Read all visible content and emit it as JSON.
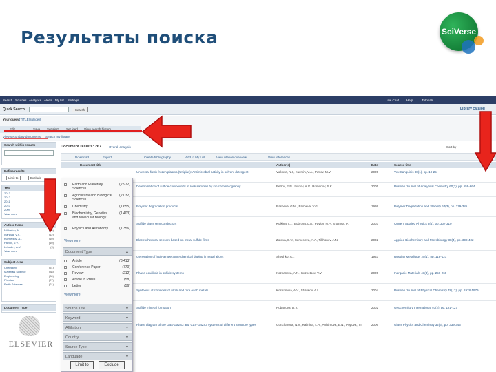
{
  "slide": {
    "title": "Результаты поиска",
    "logo_text": "SciVerse"
  },
  "nav": {
    "items": [
      "Search",
      "Sources",
      "Analytics",
      "Alerts",
      "My list",
      "Settings"
    ],
    "right": [
      "Live Chat",
      "Help",
      "Tutorials"
    ]
  },
  "search": {
    "quick_label": "Quick Search",
    "button": "Search",
    "library_link": "Library catalog"
  },
  "query": {
    "label": "Your query:",
    "value": "(TITLE(sulfide))",
    "tools": [
      "Edit",
      "Save",
      "Set alert",
      "Set feed",
      "View search history"
    ],
    "links": [
      "View secondary documents",
      "Search my library"
    ]
  },
  "results": {
    "label": "Document results:",
    "count": "267",
    "overall": "Overall analysis"
  },
  "toolbar": {
    "items": [
      "Download",
      "Export",
      "Create bibliography",
      "Add to My List",
      "View citation overview",
      "View references"
    ]
  },
  "sort_label": "Sort by",
  "table": {
    "columns": [
      "Document title",
      "Author(s)",
      "Date",
      "Source title"
    ]
  },
  "rows": [
    {
      "title": "Universal fresh frozen plasma (Uniplas): Antimicrobial activity in solvent detergent",
      "authors": "Volkova, N.I., Kuzmin, V.A., Petrov, M.V.",
      "year": "2005",
      "source": "Vox Sanguinis 88(1), pp. 19-25"
    },
    {
      "title": "Determination of sulfide compounds in rock samples by ion chromatography",
      "authors": "Petrov, E.N., Ivanov, A.V., Romanov, S.K.",
      "year": "2005",
      "source": "Russian Journal of Analytical Chemistry 60(7), pp. 659-664"
    },
    {
      "title": "Polymer degradation products",
      "authors": "Rasheva, G.M., Pasheva, V.G.",
      "year": "1999",
      "source": "Polymer Degradation and Stability 64(3), pp. 379-385"
    },
    {
      "title": "Sulfide glass semiconductors",
      "authors": "Kolkina, L.I., Bobrova, L.A., Pavlov, N.P., Shamsa, P.",
      "year": "2003",
      "source": "Current Applied Physics 3(4), pp. 307-310"
    },
    {
      "title": "Electrochemical sensors based on metal sulfide films",
      "authors": "Zotova, E.V., Semenova, A.A., Tikhonov, A.N.",
      "year": "2002",
      "source": "Applied Biochemistry and Microbiology 38(4), pp. 398-402"
    },
    {
      "title": "Generation of high-temperature chemical doping in metal alloys",
      "authors": "Sheshko, A.I.",
      "year": "1963",
      "source": "Russian Metallurgy 25(1), pp. 118-121"
    },
    {
      "title": "Phase equilibria in sulfide systems",
      "authors": "Kozhanova, A.N., Kuznetsov, V.V.",
      "year": "2005",
      "source": "Inorganic Materials 41(3), pp. 256-260"
    },
    {
      "title": "Synthesis of chlorides of alkali and rare earth metals",
      "authors": "Kostromina, A.V., Shatalov, A.I.",
      "year": "2004",
      "source": "Russian Journal of Physical Chemistry 78(12), pp. 1978-1979"
    },
    {
      "title": "Sulfide mineral formation",
      "authors": "Rubanova, D.V.",
      "year": "2002",
      "source": "Geochemistry International 40(2), pp. 121-127"
    },
    {
      "title": "Phase diagram of the GaS-Ga2S3 and CdS-Ga2S3 systems of different structure types",
      "authors": "Goncharova, N.V., Kalinina, L.A., Anisimova, E.N., Popova, T.I.",
      "year": "2006",
      "source": "Glass Physics and Chemistry 32(6), pp. 339-345"
    }
  ],
  "left": {
    "search_within": "Search within results",
    "limit_btn": "Limit to",
    "exclude_btn": "Exclude",
    "refine": "Refine results",
    "year_head": "Year",
    "years": [
      {
        "y": "2013",
        "n": "(1)"
      },
      {
        "y": "2012",
        "n": "(4)"
      },
      {
        "y": "2011",
        "n": "(4)"
      },
      {
        "y": "2010",
        "n": "(8)"
      },
      {
        "y": "2009",
        "n": "(3)"
      }
    ],
    "view_more": "View more",
    "author_head": "Author Name",
    "authors": [
      {
        "a": "Mikhailov, A.",
        "n": "(16)"
      },
      {
        "a": "Ivanova, V.S.",
        "n": "(12)"
      },
      {
        "a": "Kuznetsov, A.I.",
        "n": "(10)"
      },
      {
        "a": "Pavlov, V.V.",
        "n": "(10)"
      },
      {
        "a": "Lebedev, A.V.",
        "n": "(9)"
      }
    ],
    "subject_head": "Subject Area",
    "subjects": [
      {
        "s": "Chemistry",
        "n": "(51)"
      },
      {
        "s": "Materials Science",
        "n": "(38)"
      },
      {
        "s": "Engineering",
        "n": "(30)"
      },
      {
        "s": "Physics",
        "n": "(27)"
      },
      {
        "s": "Earth Sciences",
        "n": "(21)"
      }
    ],
    "doctype_head": "Document Type"
  },
  "popup": {
    "subjects": [
      {
        "label": "Earth and Planetary Sciences",
        "count": "(2,972)"
      },
      {
        "label": "Agricultural and Biological Sciences",
        "count": "(2,032)"
      },
      {
        "label": "Chemistry",
        "count": "(1,655)"
      },
      {
        "label": "Biochemistry, Genetics and Molecular Biology",
        "count": "(1,403)"
      },
      {
        "label": "Physics and Astronomy",
        "count": "(1,356)"
      }
    ],
    "view_more": "View more",
    "doctype_head": "Document Type",
    "doctypes": [
      {
        "label": "Article",
        "count": "(8,413)"
      },
      {
        "label": "Conference Paper",
        "count": "(770)"
      },
      {
        "label": "Review",
        "count": "(212)"
      },
      {
        "label": "Article in Press",
        "count": "(58)"
      },
      {
        "label": "Letter",
        "count": "(56)"
      }
    ],
    "sections": [
      "Source Title",
      "Keyword",
      "Affiliation",
      "Country",
      "Source Type",
      "Language"
    ],
    "limit_btn": "Limit to",
    "exclude_btn": "Exclude"
  },
  "elsevier": "ELSEVIER"
}
